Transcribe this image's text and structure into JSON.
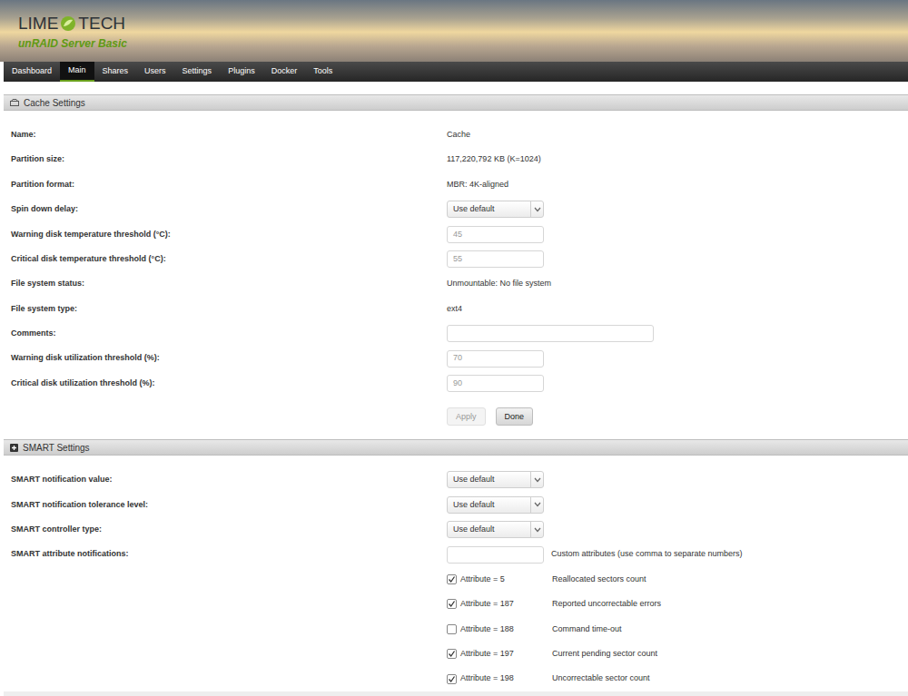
{
  "header": {
    "logo_left": "LIME",
    "logo_right": "TECH",
    "product": "unRAID Server Basic"
  },
  "nav": [
    {
      "label": "Dashboard",
      "selected": false
    },
    {
      "label": "Main",
      "selected": true
    },
    {
      "label": "Shares",
      "selected": false
    },
    {
      "label": "Users",
      "selected": false
    },
    {
      "label": "Settings",
      "selected": false
    },
    {
      "label": "Plugins",
      "selected": false
    },
    {
      "label": "Docker",
      "selected": false
    },
    {
      "label": "Tools",
      "selected": false
    }
  ],
  "cache_settings": {
    "title": "Cache Settings",
    "rows": [
      {
        "label": "Name:",
        "kind": "text",
        "value": "Cache"
      },
      {
        "label": "Partition size:",
        "kind": "text",
        "value": "117,220,792 KB (K=1024)"
      },
      {
        "label": "Partition format:",
        "kind": "text",
        "value": "MBR: 4K-aligned"
      },
      {
        "label": "Spin down delay:",
        "kind": "select",
        "value": "Use default"
      },
      {
        "label": "Warning disk temperature threshold (°C):",
        "kind": "input",
        "value": "45"
      },
      {
        "label": "Critical disk temperature threshold (°C):",
        "kind": "input",
        "value": "55"
      },
      {
        "label": "File system status:",
        "kind": "text",
        "value": "Unmountable: No file system"
      },
      {
        "label": "File system type:",
        "kind": "text",
        "value": "ext4"
      },
      {
        "label": "Comments:",
        "kind": "comment",
        "value": ""
      },
      {
        "label": "Warning disk utilization threshold (%):",
        "kind": "input",
        "value": "70"
      },
      {
        "label": "Critical disk utilization threshold (%):",
        "kind": "input",
        "value": "90"
      }
    ],
    "buttons": [
      {
        "label": "Apply",
        "disabled": true
      },
      {
        "label": "Done",
        "disabled": false
      }
    ]
  },
  "smart_settings": {
    "title": "SMART Settings",
    "rows": [
      {
        "label": "SMART notification value:",
        "kind": "select",
        "value": "Use default"
      },
      {
        "label": "SMART notification tolerance level:",
        "kind": "select",
        "value": "Use default"
      },
      {
        "label": "SMART controller type:",
        "kind": "select",
        "value": "Use default"
      },
      {
        "label": "SMART attribute notifications:",
        "kind": "input-note",
        "value": "",
        "note": "Custom attributes (use comma to separate numbers)"
      }
    ],
    "attributes": [
      {
        "label": "Attribute = 5",
        "description": "Reallocated sectors count",
        "checked": true
      },
      {
        "label": "Attribute = 187",
        "description": "Reported uncorrectable errors",
        "checked": true
      },
      {
        "label": "Attribute = 188",
        "description": "Command time-out",
        "checked": false
      },
      {
        "label": "Attribute = 197",
        "description": "Current pending sector count",
        "checked": true
      },
      {
        "label": "Attribute = 198",
        "description": "Uncorrectable sector count",
        "checked": true
      }
    ]
  }
}
